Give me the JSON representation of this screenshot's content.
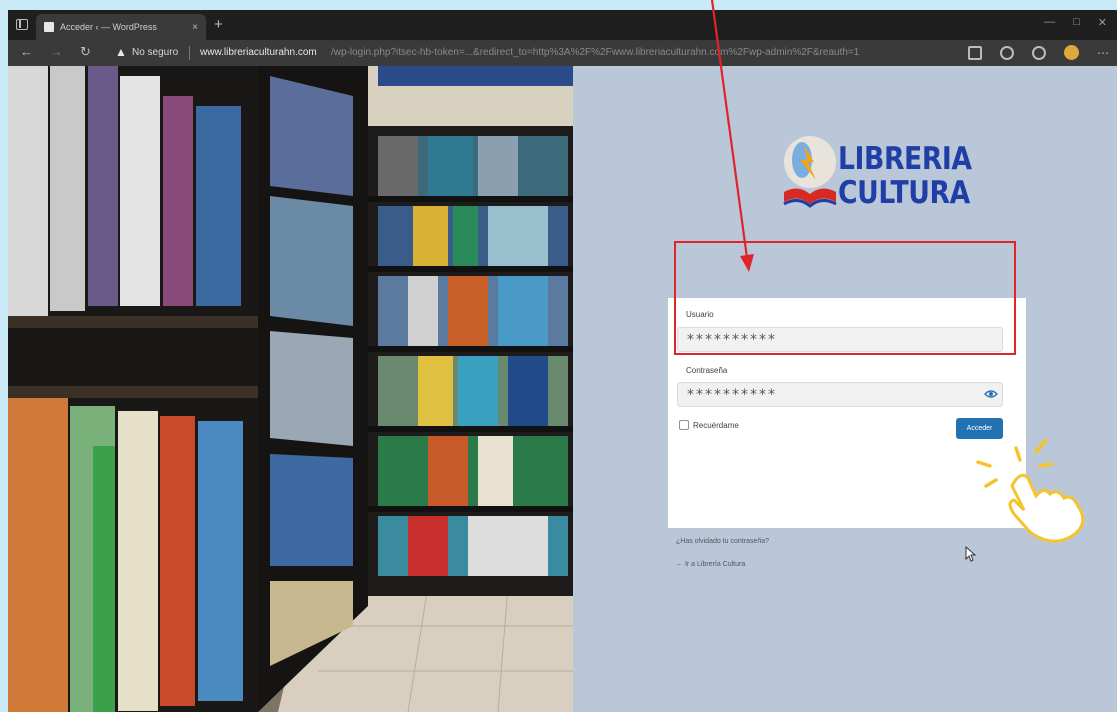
{
  "browser": {
    "tab_title": "Acceder ‹ — WordPress",
    "tab_close": "×",
    "new_tab": "+",
    "window_controls": [
      "—",
      "□",
      "✕"
    ],
    "nav_back": "←",
    "nav_forward": "→",
    "nav_reload": "↻",
    "security_warning": "No seguro",
    "url_host": "www.libreriaculturahn.com",
    "url_rest": "/wp-login.php?itsec-hb-token=...&redirect_to=http%3A%2F%2Fwww.libreriaculturahn.com%2Fwp-admin%2F&reauth=1",
    "icons": [
      "tab-sidebar-icon",
      "favicon-icon",
      "warning-icon",
      "split-view-icon",
      "extensions-icon",
      "favorites-icon",
      "profile-icon",
      "more-icon"
    ]
  },
  "logo": {
    "line1": "LIBRERIA",
    "line2": "CULTURA",
    "brand_blue": "#1f3ea6",
    "book_red": "#d72a22"
  },
  "login": {
    "username_label": "Usuario",
    "username_value": "**********",
    "password_label": "Contraseña",
    "password_value": "**********",
    "remember_label": "Recuérdame",
    "submit_label": "Acceder",
    "lost_password": "¿Has olvidado tu contraseña?",
    "back_link": "← Ir a Librería Cultura",
    "accent": "#2271b1"
  },
  "annotations": {
    "highlight_color": "#e0242c",
    "tap_color": "#f5c42c"
  }
}
